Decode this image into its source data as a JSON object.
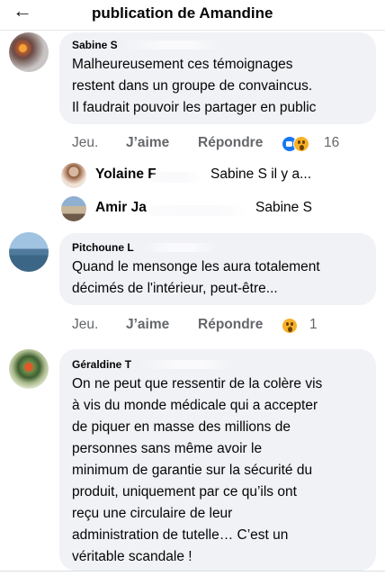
{
  "header": {
    "back_icon": "arrow-left-icon",
    "title": "publication de Amandine"
  },
  "comments": [
    {
      "author": "Sabine S",
      "text": "Malheureusement ces témoignages\nrestent dans un groupe de convaincus.\nIl faudrait pouvoir les partager en public",
      "time": "Jeu.",
      "like_label": "J’aime",
      "reply_label": "Répondre",
      "reactions": [
        "like",
        "wow"
      ],
      "reaction_count": "16",
      "replies": [
        {
          "name": "Yolaine F",
          "snippet": "Sabine S    il y a..."
        },
        {
          "name": "Amir Ja",
          "snippet": "Sabine S"
        }
      ]
    },
    {
      "author": "Pitchoune L",
      "text": "Quand le mensonge les aura totalement\ndécimés de l'intérieur, peut-être...",
      "time": "Jeu.",
      "like_label": "J’aime",
      "reply_label": "Répondre",
      "reactions": [
        "wow"
      ],
      "reaction_count": "1"
    },
    {
      "author": "Géraldine T",
      "text": "On ne peut que ressentir de la colère vis\nà vis du monde médicale qui a accepter\nde piquer en masse des millions de\npersonnes sans même avoir le\nminimum de garantie  sur la sécurité du\nproduit, uniquement par ce qu’ils ont\nreçu une circulaire de leur\nadministration de tutelle… C’est un\nvéritable scandale !"
    }
  ],
  "colors": {
    "bubble": "#f0f2f5",
    "secondary_text": "#65676b",
    "like_blue": "#1877f2",
    "wow_yellow": "#f7b125"
  }
}
